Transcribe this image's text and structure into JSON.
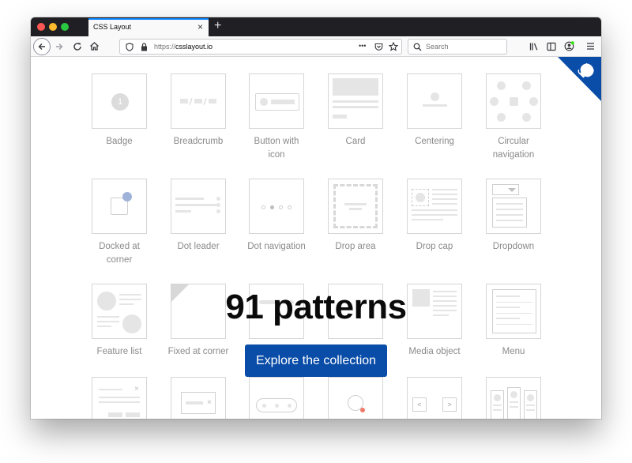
{
  "browser": {
    "tab_title": "CSS Layout",
    "tab_close": "×",
    "new_tab": "+",
    "url_scheme": "https://",
    "url_host": "csslayout.io",
    "search_placeholder": "Search",
    "page_actions": "•••"
  },
  "hero": {
    "title": "91 patterns",
    "cta_label": "Explore the collection"
  },
  "patterns": [
    {
      "line1": "Badge",
      "line2": ""
    },
    {
      "line1": "Breadcrumb",
      "line2": ""
    },
    {
      "line1": "Button with",
      "line2": "icon"
    },
    {
      "line1": "Card",
      "line2": ""
    },
    {
      "line1": "Centering",
      "line2": ""
    },
    {
      "line1": "Circular",
      "line2": "navigation"
    },
    {
      "line1": "Docked at",
      "line2": "corner"
    },
    {
      "line1": "Dot leader",
      "line2": ""
    },
    {
      "line1": "Dot navigation",
      "line2": ""
    },
    {
      "line1": "Drop area",
      "line2": ""
    },
    {
      "line1": "Drop cap",
      "line2": ""
    },
    {
      "line1": "Dropdown",
      "line2": ""
    },
    {
      "line1": "Feature list",
      "line2": ""
    },
    {
      "line1": "Fixed at corner",
      "line2": ""
    },
    {
      "line1": "",
      "line2": ""
    },
    {
      "line1": "",
      "line2": ""
    },
    {
      "line1": "Media object",
      "line2": ""
    },
    {
      "line1": "Menu",
      "line2": ""
    }
  ],
  "badge_number": "1",
  "accent_color": "#0a4da8",
  "icons": [
    "back-arrow-icon",
    "forward-arrow-icon",
    "reload-icon",
    "home-icon",
    "shield-icon",
    "lock-icon",
    "pocket-icon",
    "bookmark-star-icon",
    "search-icon",
    "library-icon",
    "sidebar-icon",
    "account-icon",
    "hamburger-menu-icon",
    "github-cat-icon"
  ]
}
